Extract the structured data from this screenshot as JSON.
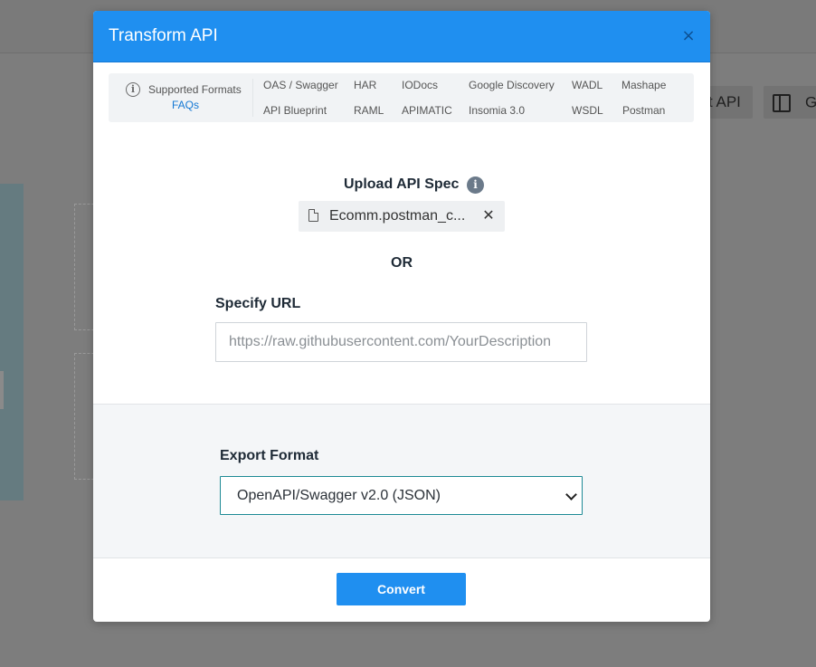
{
  "background": {
    "import_api_button_partial": "t API",
    "g_button_partial": "G"
  },
  "modal": {
    "title": "Transform API",
    "close_label": "×",
    "supported_formats": {
      "label": "Supported Formats",
      "faqs_link": "FAQs",
      "formats": [
        "OAS / Swagger",
        "HAR",
        "IODocs",
        "Google Discovery",
        "WADL",
        "Mashape",
        "API Blueprint",
        "RAML",
        "APIMATIC",
        "Insomia 3.0",
        "WSDL",
        "Postman"
      ]
    },
    "upload": {
      "title": "Upload API Spec",
      "info_icon": "i",
      "file_name": "Ecomm.postman_c...",
      "remove_label": "✕"
    },
    "or_text": "OR",
    "url": {
      "label": "Specify URL",
      "placeholder": "https://raw.githubusercontent.com/YourDescription",
      "value": ""
    },
    "export": {
      "label": "Export Format",
      "selected": "OpenAPI/Swagger v2.0 (JSON)"
    },
    "convert_label": "Convert"
  },
  "colors": {
    "header_blue": "#1f8ff0",
    "link_blue": "#1478d4",
    "select_border": "#1d8a95",
    "overlay_grey": "#7d7d7d"
  },
  "icons": [
    "info-circle-icon",
    "info-icon",
    "file-icon",
    "close-icon",
    "chevron-down-icon",
    "sidebar-toggle-icon"
  ]
}
